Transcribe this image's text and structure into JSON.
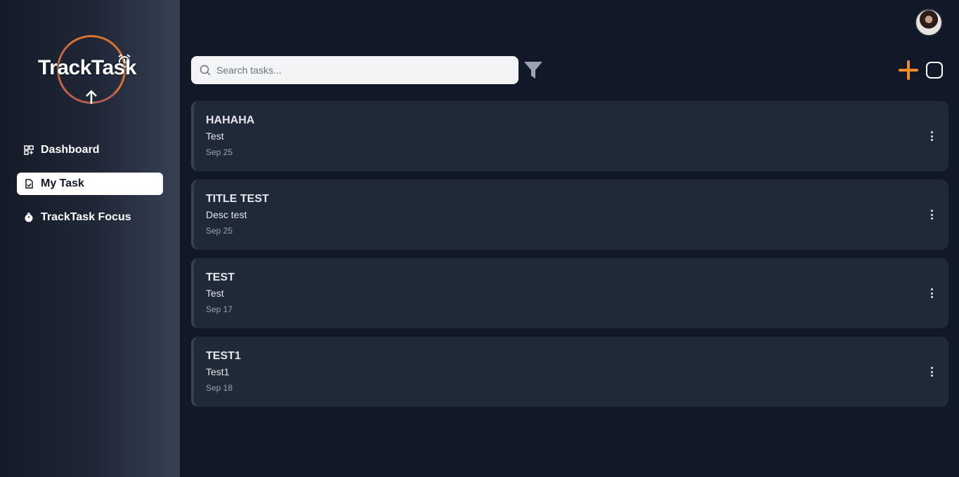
{
  "app": {
    "logo_text": "TrackTask",
    "accent_color": "#f28c28"
  },
  "sidebar": {
    "items": [
      {
        "label": "Dashboard",
        "icon": "dashboard-grid-icon",
        "active": false
      },
      {
        "label": "My Task",
        "icon": "task-document-icon",
        "active": true
      },
      {
        "label": "TrackTask Focus",
        "icon": "stopwatch-icon",
        "active": false
      }
    ]
  },
  "header": {
    "avatar": "user-avatar",
    "search_placeholder": "Search tasks...",
    "filter_icon": "filter-funnel-icon",
    "add_icon": "plus-icon",
    "select_icon": "square-checkbox-icon"
  },
  "tasks": [
    {
      "title": "HAHAHA",
      "description": "Test",
      "date": "Sep 25"
    },
    {
      "title": "TITLE TEST",
      "description": "Desc test",
      "date": "Sep 25"
    },
    {
      "title": "TEST",
      "description": "Test",
      "date": "Sep 17"
    },
    {
      "title": "TEST1",
      "description": "Test1",
      "date": "Sep 18"
    }
  ]
}
